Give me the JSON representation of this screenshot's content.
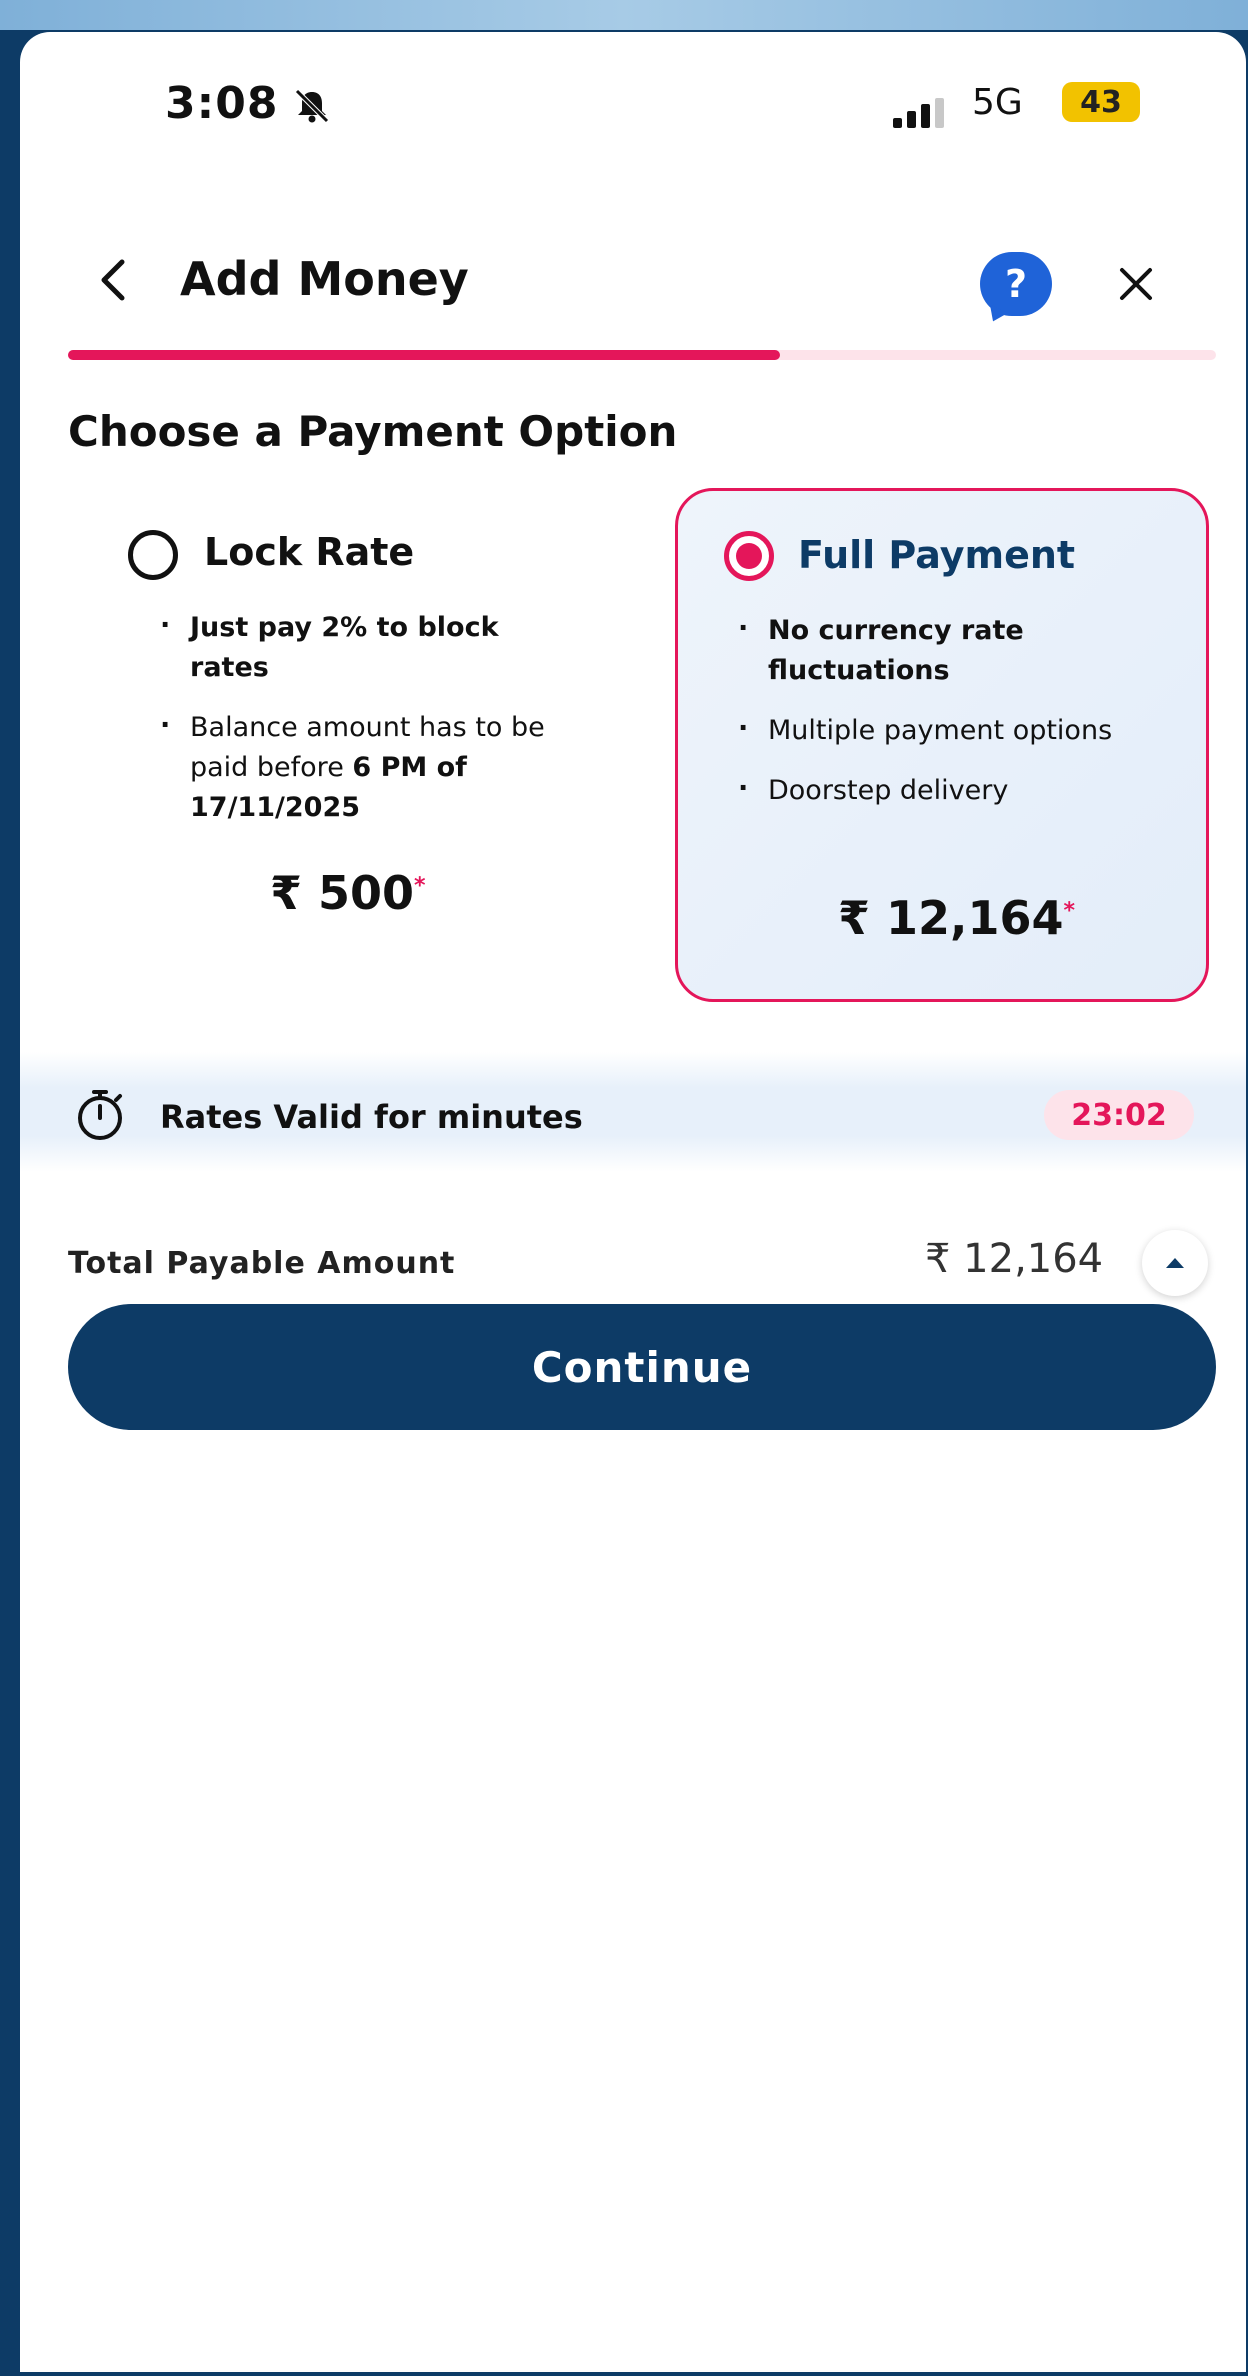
{
  "status_bar": {
    "time": "3:08",
    "network": "5G",
    "battery": "43",
    "icons": [
      "bell-slash-icon",
      "signal-icon"
    ]
  },
  "header": {
    "title": "Add Money",
    "icons": [
      "back-icon",
      "help-icon",
      "close-icon"
    ],
    "help_symbol": "?",
    "progress_fraction": 0.62
  },
  "section_title": "Choose a Payment Option",
  "options": [
    {
      "label": "Lock Rate",
      "selected": false,
      "price": "₹ 500",
      "price_marker": "*"
    },
    {
      "label": "Full Payment",
      "selected": true,
      "bullets": [
        "No currency rate fluctuations",
        "Multiple payment options",
        "Doorstep delivery"
      ],
      "price": "₹ 12,164",
      "price_marker": "*"
    }
  ],
  "lock_bullet1": "Just pay 2% to block rates",
  "lock_bullet2": {
    "pre": "Balance amount has to be paid before ",
    "bold": "6 PM",
    "post": " of 17/11/2025"
  },
  "timer": {
    "icon": "stopwatch-icon",
    "label": "Rates Valid for minutes",
    "value": "23:02"
  },
  "total": {
    "label": "Total Payable Amount",
    "value": "₹ 12,164",
    "icon": "chevron-up-icon"
  },
  "continue_label": "Continue",
  "colors": {
    "brand_navy": "#0d3b66",
    "accent_pink": "#e4165a",
    "help_blue": "#1f63d8",
    "battery_yellow": "#f2c200"
  }
}
